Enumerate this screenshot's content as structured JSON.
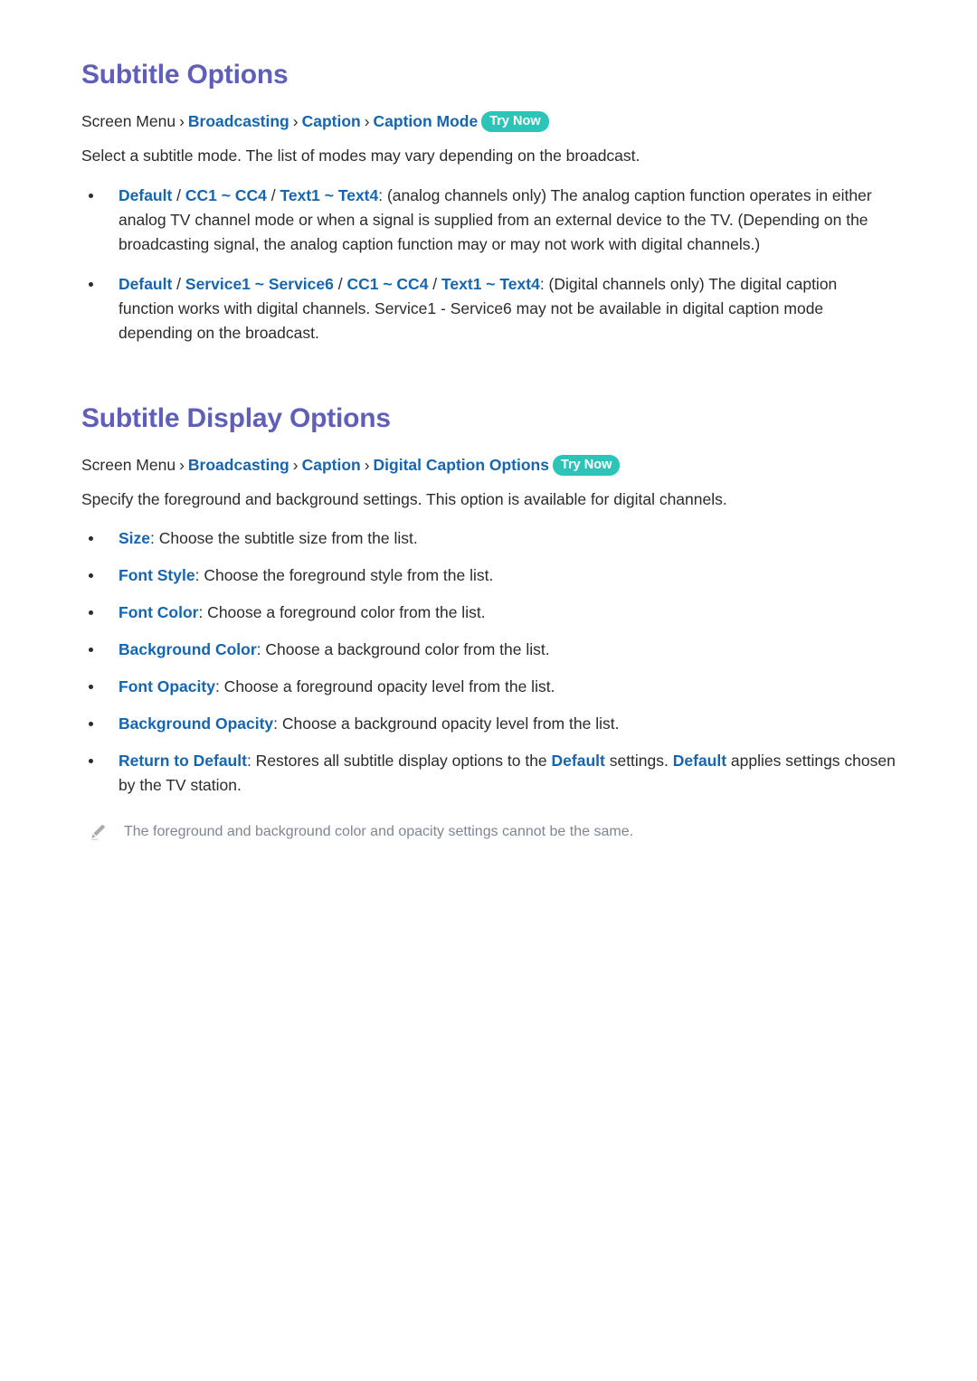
{
  "document": {
    "sections": [
      {
        "id": "subtitle-options",
        "heading": "Subtitle Options",
        "breadcrumb": {
          "root": "Screen Menu",
          "separator": "›",
          "links": [
            "Broadcasting",
            "Caption",
            "Caption Mode"
          ],
          "badge": "Try Now"
        },
        "intro": "Select a subtitle mode. The list of modes may vary depending on the broadcast.",
        "bullets": [
          {
            "terms": [
              "Default",
              "CC1 ~ CC4",
              "Text1 ~ Text4"
            ],
            "term_separator": "/",
            "text": ": (analog channels only) The analog caption function operates in either analog TV channel mode or when a signal is supplied from an external device to the TV. (Depending on the broadcasting signal, the analog caption function may or may not work with digital channels.)"
          },
          {
            "terms": [
              "Default",
              "Service1 ~ Service6",
              "CC1 ~ CC4",
              "Text1 ~ Text4"
            ],
            "term_separator": "/",
            "text": ": (Digital channels only) The digital caption function works with digital channels. Service1 - Service6 may not be available in digital caption mode depending on the broadcast."
          }
        ]
      },
      {
        "id": "subtitle-display-options",
        "heading": "Subtitle Display Options",
        "breadcrumb": {
          "root": "Screen Menu",
          "separator": "›",
          "links": [
            "Broadcasting",
            "Caption",
            "Digital Caption Options"
          ],
          "badge": "Try Now"
        },
        "intro": "Specify the foreground and background settings. This option is available for digital channels.",
        "bullets": [
          {
            "term": "Size",
            "text": ": Choose the subtitle size from the list."
          },
          {
            "term": "Font Style",
            "text": ": Choose the foreground style from the list."
          },
          {
            "term": "Font Color",
            "text": ": Choose a foreground color from the list."
          },
          {
            "term": "Background Color",
            "text": ": Choose a background color from the list."
          },
          {
            "term": "Font Opacity",
            "text": ": Choose a foreground opacity level from the list."
          },
          {
            "term": "Background Opacity",
            "text": ": Choose a background opacity level from the list."
          },
          {
            "term": "Return to Default",
            "text_parts": [
              {
                "type": "plain",
                "text": ": Restores all subtitle display options to the "
              },
              {
                "type": "link",
                "text": "Default"
              },
              {
                "type": "plain",
                "text": " settings. "
              },
              {
                "type": "link",
                "text": "Default"
              },
              {
                "type": "plain",
                "text": " applies settings chosen by the TV station."
              }
            ]
          }
        ],
        "note": {
          "icon": "pencil-icon",
          "text": "The foreground and background color and opacity settings cannot be the same."
        }
      }
    ]
  },
  "colors": {
    "heading": "#5f5fba",
    "link": "#1565b0",
    "badge_bg": "#2cc3b8",
    "badge_text": "#ffffff",
    "body_text": "#2b2b2b",
    "note_text": "#7f8693",
    "background": "#ffffff"
  }
}
